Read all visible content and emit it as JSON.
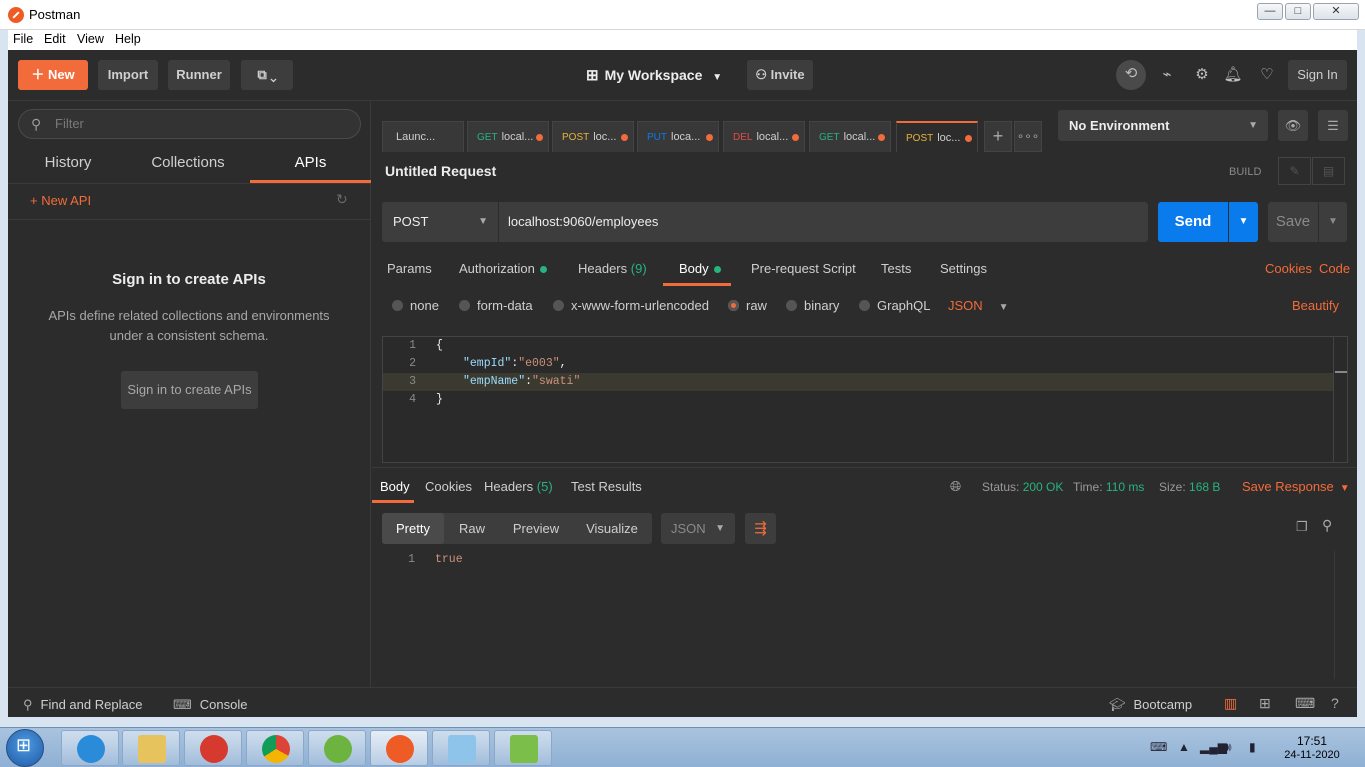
{
  "window": {
    "title": "Postman",
    "min": "—",
    "max": "□",
    "close": "✕"
  },
  "menu": [
    "File",
    "Edit",
    "View",
    "Help"
  ],
  "header": {
    "new_label": "New",
    "import_label": "Import",
    "runner_label": "Runner",
    "workspace_label": "My Workspace",
    "invite_label": "Invite",
    "signin_label": "Sign In"
  },
  "sidebar": {
    "filter_placeholder": "Filter",
    "tabs": [
      "History",
      "Collections",
      "APIs"
    ],
    "new_api_label": "+ New API",
    "empty_title": "Sign in to create APIs",
    "empty_desc": "APIs define related collections and environments under a consistent schema.",
    "empty_button": "Sign in to create APIs"
  },
  "request_tabs": [
    {
      "method": "",
      "label": "Launc...",
      "method_color": "#cfcfcf"
    },
    {
      "method": "GET",
      "label": "local...",
      "method_color": "#26b47f"
    },
    {
      "method": "POST",
      "label": "loc...",
      "method_color": "#e8b33a"
    },
    {
      "method": "PUT",
      "label": "loca...",
      "method_color": "#097bed"
    },
    {
      "method": "DEL",
      "label": "local...",
      "method_color": "#e34a4a"
    },
    {
      "method": "GET",
      "label": "local...",
      "method_color": "#26b47f"
    },
    {
      "method": "POST",
      "label": "loc...",
      "method_color": "#e8b33a"
    }
  ],
  "environment": {
    "label": "No Environment"
  },
  "request": {
    "title": "Untitled Request",
    "build_label": "BUILD",
    "method": "POST",
    "url": "localhost:9060/employees",
    "send_label": "Send",
    "save_label": "Save"
  },
  "param_tabs": {
    "params": "Params",
    "authorization": "Authorization",
    "headers": "Headers",
    "headers_count": "(9)",
    "body": "Body",
    "prerequest": "Pre-request Script",
    "tests": "Tests",
    "settings": "Settings",
    "cookies_link": "Cookies",
    "code_link": "Code"
  },
  "body_types": {
    "none": "none",
    "form_data": "form-data",
    "urlencoded": "x-www-form-urlencoded",
    "raw": "raw",
    "binary": "binary",
    "graphql": "GraphQL",
    "format": "JSON",
    "beautify": "Beautify"
  },
  "editor_lines": [
    {
      "n": "1",
      "text": "{"
    },
    {
      "n": "2",
      "key": "\"empId\"",
      "colon": ":",
      "value": "\"e003\"",
      "tail": ","
    },
    {
      "n": "3",
      "key": "\"empName\"",
      "colon": ":",
      "value": "\"swati\"",
      "tail": ""
    },
    {
      "n": "4",
      "text": "}"
    }
  ],
  "response": {
    "tabs": {
      "body": "Body",
      "cookies": "Cookies",
      "headers": "Headers",
      "headers_count": "(5)",
      "test_results": "Test Results"
    },
    "status_label": "Status:",
    "status_value": "200 OK",
    "time_label": "Time:",
    "time_value": "110 ms",
    "size_label": "Size:",
    "size_value": "168 B",
    "save_label": "Save Response",
    "views": [
      "Pretty",
      "Raw",
      "Preview",
      "Visualize"
    ],
    "format": "JSON",
    "line_no": "1",
    "body_text": "true"
  },
  "footer": {
    "find_replace": "Find and Replace",
    "console": "Console",
    "bootcamp": "Bootcamp"
  },
  "taskbar": {
    "time": "17:51",
    "date": "24-11-2020"
  },
  "colors": {
    "accent": "#f26b3a",
    "send_blue": "#097bed",
    "status_green": "#26b47f"
  }
}
